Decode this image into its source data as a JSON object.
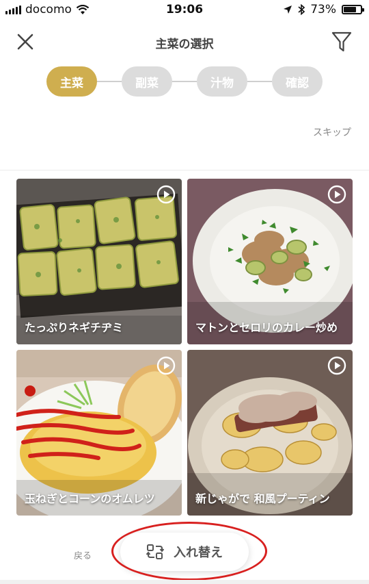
{
  "status_bar": {
    "carrier": "docomo",
    "time": "19:06",
    "battery": "73%",
    "battery_level": 0.73
  },
  "header": {
    "title": "主菜の選択",
    "close_icon": "close-icon",
    "filter_icon": "filter-icon"
  },
  "steps": [
    {
      "label": "主菜",
      "active": true
    },
    {
      "label": "副菜",
      "active": false
    },
    {
      "label": "汁物",
      "active": false
    },
    {
      "label": "確認",
      "active": false
    }
  ],
  "skip_label": "スキップ",
  "recipes": [
    {
      "name": "たっぷりネギチヂミ",
      "icon": "play-icon"
    },
    {
      "name": "マトンとセロリのカレー炒め",
      "icon": "play-icon"
    },
    {
      "name": "玉ねぎとコーンのオムレツ",
      "icon": "play-icon"
    },
    {
      "name": "新じゃがで 和風プーティン",
      "icon": "play-icon"
    }
  ],
  "footer": {
    "back_label": "戻る",
    "shuffle_label": "入れ替え",
    "shuffle_icon": "shuffle-icon"
  },
  "colors": {
    "accent": "#cfae4f",
    "inactive_step": "#dcdcdc",
    "annotation": "#d8201f"
  }
}
